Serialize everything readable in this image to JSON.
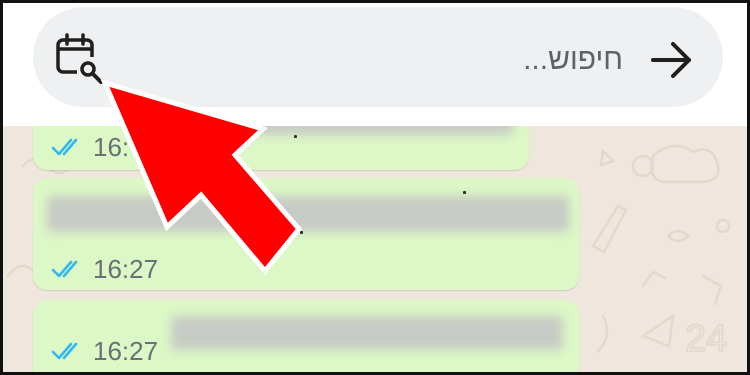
{
  "search": {
    "placeholder": "חיפוש...",
    "calendar_icon": "calendar-search-icon",
    "back_icon": "arrow-right-icon"
  },
  "messages": [
    {
      "time": "16:",
      "status_icon": "double-check-icon"
    },
    {
      "time": "16:27",
      "status_icon": "double-check-icon"
    },
    {
      "time": "16:27",
      "status_icon": "double-check-icon"
    }
  ],
  "colors": {
    "accent_red": "#ff0000",
    "bubble_green": "#dcf8c6",
    "tick_blue": "#34b7f1",
    "search_bg": "#eef0f2",
    "chat_bg": "#efe7dd"
  }
}
